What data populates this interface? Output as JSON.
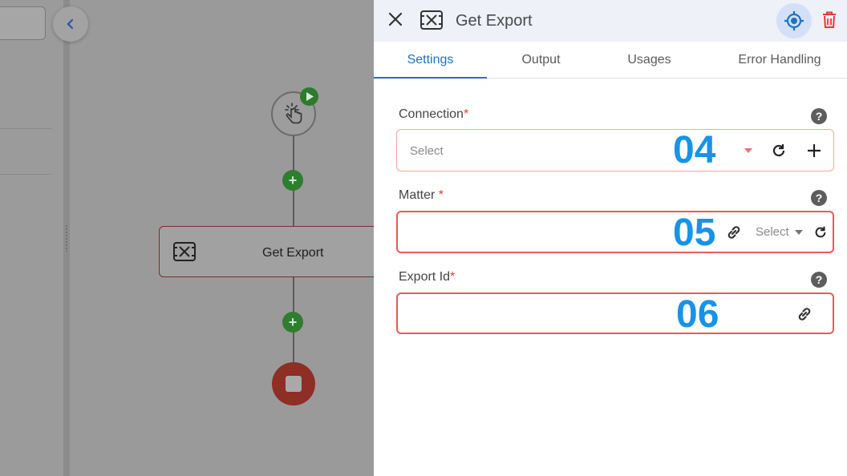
{
  "canvas": {
    "step_node_label": "Get Export"
  },
  "panel": {
    "title": "Get Export",
    "tabs": [
      {
        "label": "Settings",
        "active": true
      },
      {
        "label": "Output",
        "active": false
      },
      {
        "label": "Usages",
        "active": false
      },
      {
        "label": "Error Handling",
        "active": false
      }
    ],
    "fields": {
      "connection": {
        "label": "Connection",
        "required_mark": "*",
        "placeholder": "Select",
        "annotation": "04",
        "help": "?"
      },
      "matter": {
        "label": "Matter",
        "required_mark": "*",
        "annotation": "05",
        "select_label": "Select",
        "help": "?"
      },
      "export_id": {
        "label": "Export Id",
        "required_mark": "*",
        "annotation": "06",
        "help": "?"
      }
    }
  },
  "colors": {
    "accent": "#1a73c8",
    "required": "#e53935",
    "annotation": "#1793e8",
    "stop_node": "#8e2e24",
    "add_button": "#2f7d2f"
  },
  "icons": [
    "chevron-left-icon",
    "hand-pointer-icon",
    "play-icon",
    "plus-icon",
    "export-step-icon",
    "stop-icon",
    "close-icon",
    "target-icon",
    "trash-icon",
    "help-icon",
    "dropdown-caret-icon",
    "refresh-icon",
    "add-icon",
    "link-icon"
  ]
}
